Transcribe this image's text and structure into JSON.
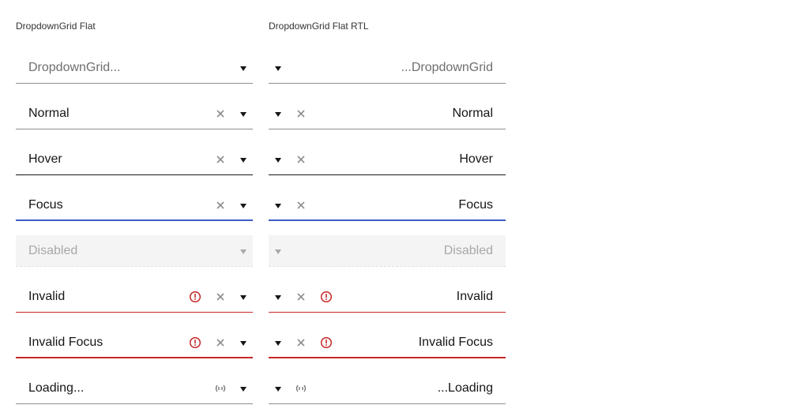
{
  "ltr": {
    "heading": "DropdownGrid Flat",
    "fields": {
      "placeholder": "DropdownGrid...",
      "normal": "Normal",
      "hover": "Hover",
      "focus": "Focus",
      "disabled": "Disabled",
      "invalid": "Invalid",
      "invalid_focus": "Invalid Focus",
      "loading": "Loading..."
    }
  },
  "rtl": {
    "heading": "DropdownGrid Flat RTL",
    "fields": {
      "placeholder": "...DropdownGrid",
      "normal": "Normal",
      "hover": "Hover",
      "focus": "Focus",
      "disabled": "Disabled",
      "invalid": "Invalid",
      "invalid_focus": "Invalid Focus",
      "loading": "...Loading"
    }
  },
  "colors": {
    "focus": "#3b5cc4",
    "invalid": "#c62828",
    "text": "#161616",
    "placeholder": "#6f6f6f",
    "icon": "#8d8d8d"
  },
  "icons": [
    "chevron-down-icon",
    "clear-icon",
    "error-icon",
    "loading-icon"
  ]
}
